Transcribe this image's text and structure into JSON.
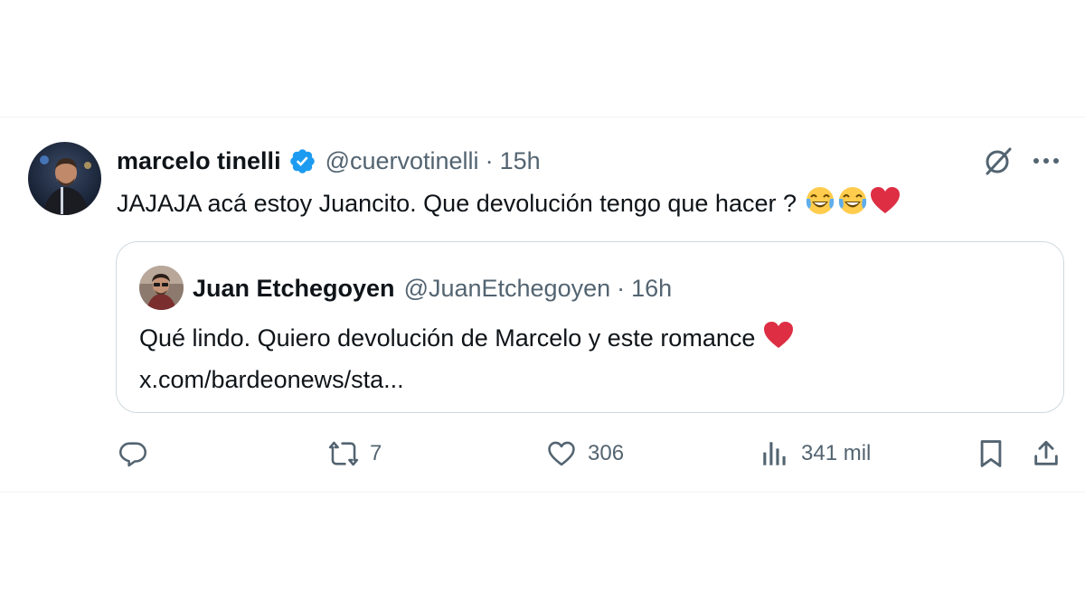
{
  "tweet": {
    "author_name": "marcelo tinelli",
    "handle": "@cuervotinelli",
    "separator": "·",
    "time": "15h",
    "text": "JAJAJA acá estoy Juancito. Que devolución tengo que hacer ?",
    "icons": [
      "verified-icon",
      "grok-icon",
      "more-icon",
      "laughing-emoji",
      "laughing-emoji",
      "heart-emoji"
    ]
  },
  "quote": {
    "author_name": "Juan Etchegoyen",
    "handle": "@JuanEtchegoyen",
    "separator": "·",
    "time": "16h",
    "text": "Qué lindo. Quiero devolución de Marcelo y este romance",
    "link": "x.com/bardeonews/sta..."
  },
  "actions": {
    "reply_count": "",
    "retweet_count": "7",
    "like_count": "306",
    "views_count": "341 mil"
  },
  "colors": {
    "text": "#0f1419",
    "secondary": "#536471",
    "verified": "#1d9bf0",
    "border": "#cfd9de"
  }
}
